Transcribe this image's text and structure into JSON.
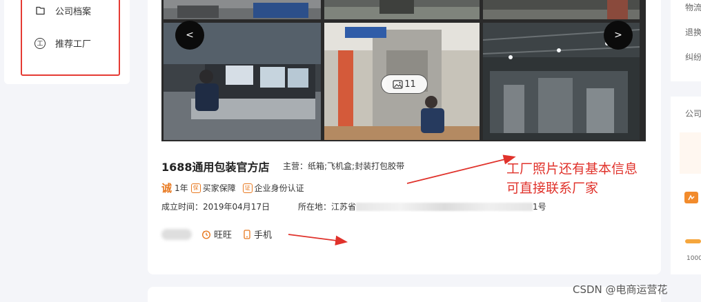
{
  "sidebar": {
    "items": [
      {
        "label": "公司档案",
        "icon": "folder-icon"
      },
      {
        "label": "推荐工厂",
        "icon": "factory-badge-icon",
        "icon_glyph": "工"
      }
    ]
  },
  "gallery": {
    "prev_label": "<",
    "next_label": ">",
    "image_count": "11"
  },
  "store": {
    "name": "1688通用包装官方店",
    "main_business": "主营：纸箱;飞机盒;封装打包胶带",
    "cheng_badge": "诚",
    "years": "1年",
    "buyer_protection_icon": "保",
    "buyer_protection": "买家保障",
    "enterprise_icon": "证",
    "enterprise_verified": "企业身份认证",
    "established": "成立时间：2019年04月17日",
    "location_prefix": "所在地：江苏省",
    "location_suffix": "1号"
  },
  "contacts": {
    "wangwang": "旺旺",
    "mobile": "手机"
  },
  "annotation": {
    "line1": "工厂照片还有基本信息",
    "line2": "可直接联系厂家"
  },
  "right_panel": {
    "items": [
      "物流",
      "退换",
      "纠纷"
    ],
    "company_label": "公司",
    "number": "1000"
  },
  "watermark": "CSDN @电商运营花",
  "colors": {
    "annotation_red": "#e0322b",
    "badge_orange": "#e8781e",
    "highlight_box": "#e53a33"
  }
}
